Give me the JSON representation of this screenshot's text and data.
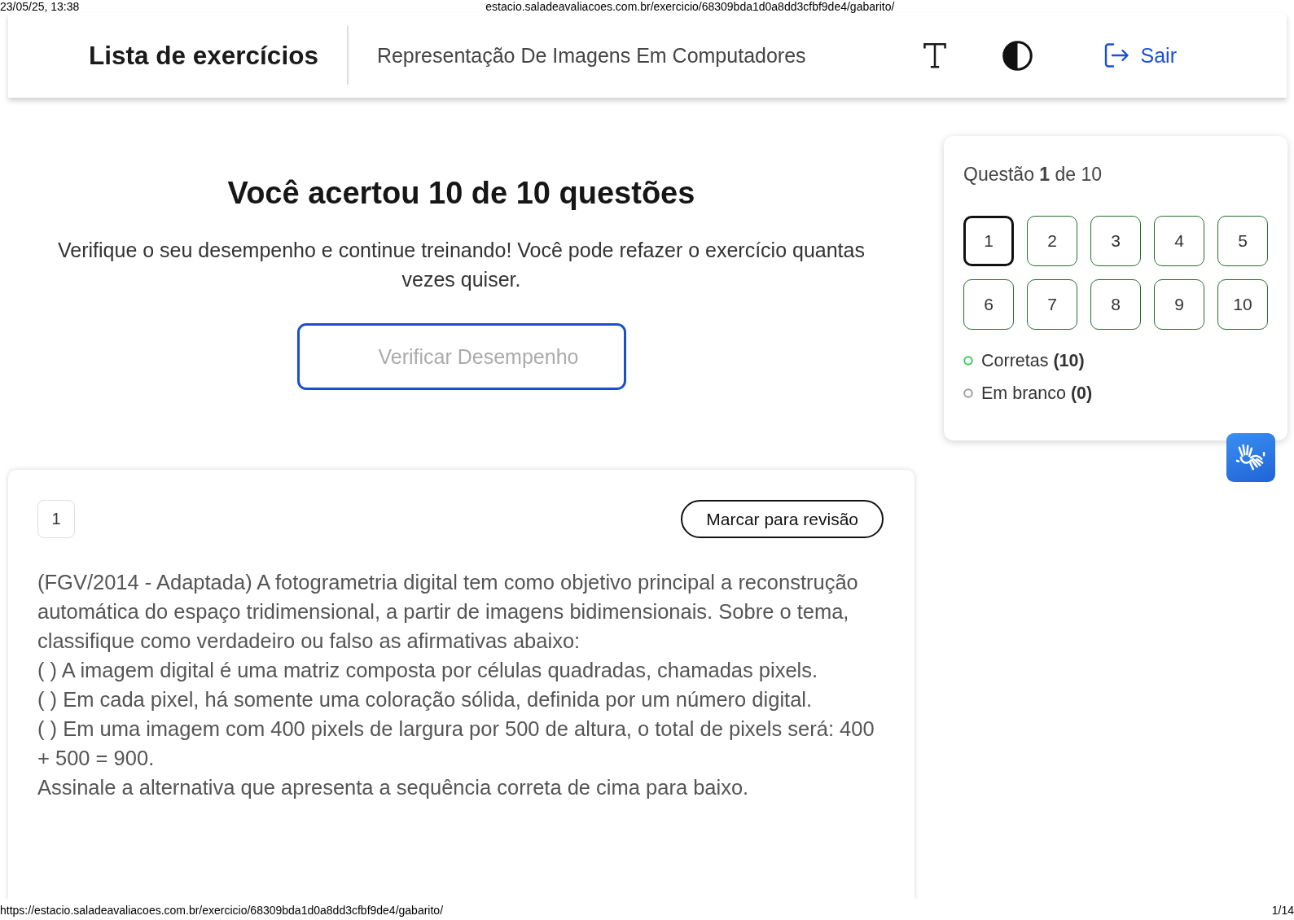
{
  "print_header": {
    "date_time": "23/05/25, 13:38",
    "page_title": "estacio.saladeavaliacoes.com.br/exercicio/68309bda1d0a8dd3cfbf9de4/gabarito/"
  },
  "header": {
    "title": "Lista de exercícios",
    "subject": "Representação De Imagens Em Computadores",
    "logout": {
      "label": "Sair"
    }
  },
  "result": {
    "heading": "Você acertou 10 de 10 questões",
    "message": "Verifique o seu desempenho e continue treinando! Você pode refazer o exercício quantas vezes quiser.",
    "button": {
      "label": "Verificar Desempenho",
      "disabled": true
    }
  },
  "navigator": {
    "title": "Questão **1** de 10",
    "questions": [
      {
        "label": "1",
        "selected": true,
        "correct": true
      },
      {
        "label": "2",
        "selected": false,
        "correct": true
      },
      {
        "label": "3",
        "selected": false,
        "correct": true
      },
      {
        "label": "4",
        "selected": false,
        "correct": true
      },
      {
        "label": "5",
        "selected": false,
        "correct": true
      },
      {
        "label": "6",
        "selected": false,
        "correct": true
      },
      {
        "label": "7",
        "selected": false,
        "correct": true
      },
      {
        "label": "8",
        "selected": false,
        "correct": true
      },
      {
        "label": "9",
        "selected": false,
        "correct": true
      },
      {
        "label": "10",
        "selected": false,
        "correct": true
      }
    ],
    "legend": [
      {
        "label": "Corretas **(10)**",
        "color": "#3ccb5a"
      },
      {
        "label": "Em branco **(0)**",
        "color": "#9e9e9e"
      }
    ]
  },
  "question": {
    "number": "1",
    "review_button": "Marcar para revisão",
    "statement": "(FGV/2014 - Adaptada) A fotogrametria digital tem como objetivo principal a reconstrução automática do espaço tridimensional, a partir de imagens bidimensionais. Sobre o tema, classifique como verdadeiro ou falso as afirmativas abaixo:",
    "items": [
      "( ) A imagem digital é uma matriz composta por células quadradas, chamadas pixels.",
      "( ) Em cada pixel, há somente uma coloração sólida, definida por um número digital.",
      "( ) Em uma imagem com 400 pixels de largura por 500 de altura, o total de pixels será: 400 + 500 = 900."
    ],
    "instruction": "Assinale a alternativa que apresenta a sequência correta de cima para baixo."
  },
  "print_footer": {
    "url": "https://estacio.saladeavaliacoes.com.br/exercicio/68309bda1d0a8dd3cfbf9de4/gabarito/",
    "page": "1/14"
  }
}
